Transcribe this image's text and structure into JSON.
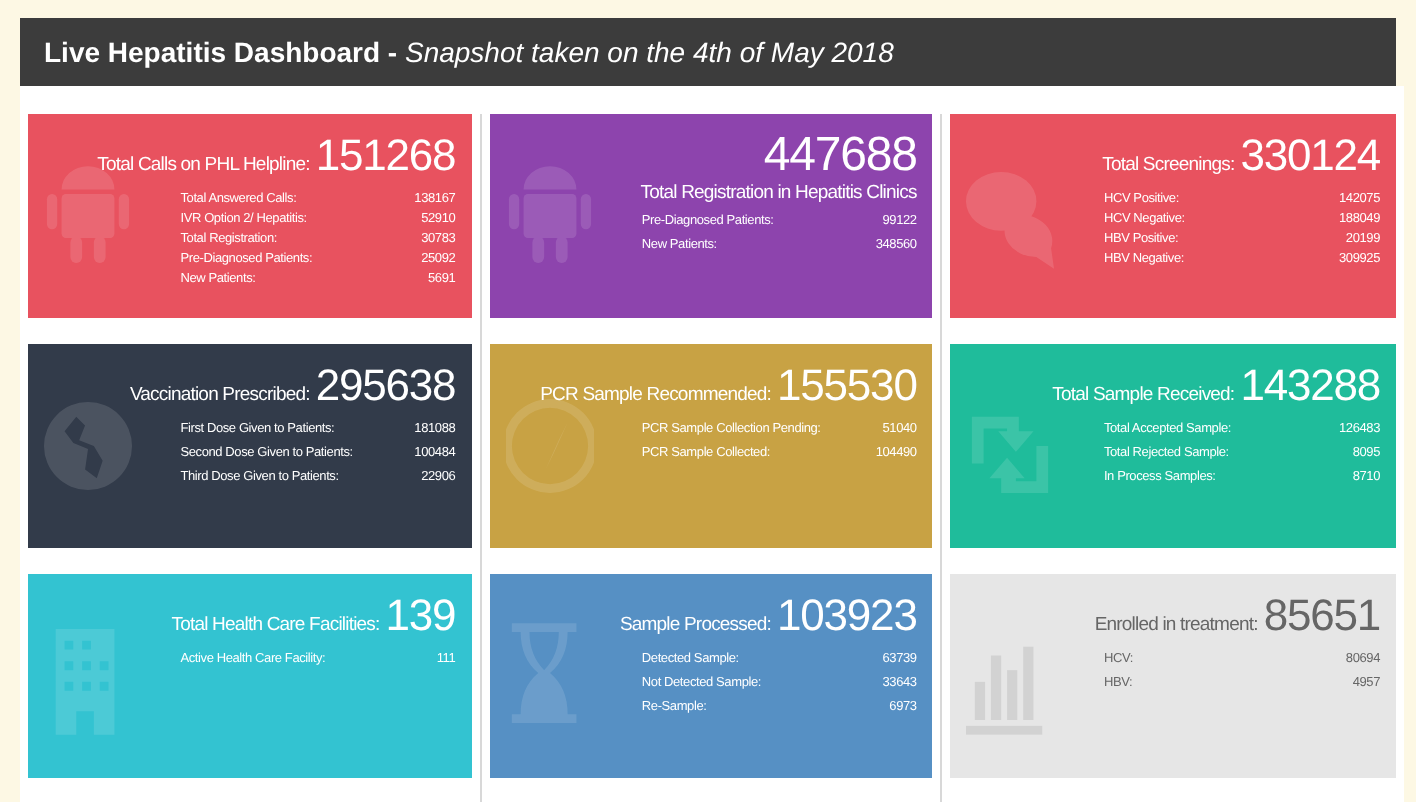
{
  "header": {
    "title": "**Live Hepatitis Dashboard -** *Snapshot taken on the 4th of May 2018*"
  },
  "cards": [
    {
      "kind": "label-first",
      "color": "#e8525f",
      "title": "Total Calls on PHL Helpline:",
      "total": "151268",
      "rows": [
        {
          "label": "Total Answered Calls:",
          "value": "138167"
        },
        {
          "label": "IVR Option 2/ Hepatitis:",
          "value": "52910"
        },
        {
          "label": "Total Registration:",
          "value": "30783"
        },
        {
          "label": "Pre-Diagnosed Patients:",
          "value": "25092"
        },
        {
          "label": "New Patients:",
          "value": "5691"
        }
      ]
    },
    {
      "kind": "number-first",
      "color": "#8d44ad",
      "title": "Total Registration in Hepatitis Clinics",
      "total": "447688",
      "rows": [
        {
          "label": "Pre-Diagnosed Patients:",
          "value": "99122"
        },
        {
          "label": "New Patients:",
          "value": "348560"
        }
      ]
    },
    {
      "kind": "label-first",
      "color": "#e8525f",
      "title": "Total Screenings:",
      "total": "330124",
      "rows": [
        {
          "label": "HCV Positive:",
          "value": "142075"
        },
        {
          "label": "HCV Negative:",
          "value": "188049"
        },
        {
          "label": "HBV Positive:",
          "value": "20199"
        },
        {
          "label": "HBV Negative:",
          "value": "309925"
        }
      ]
    },
    {
      "kind": "label-first",
      "color": "#323b4a",
      "title": "Vaccination Prescribed:",
      "total": "295638",
      "rows": [
        {
          "label": "First Dose Given to Patients:",
          "value": "181088"
        },
        {
          "label": "Second Dose Given to Patients:",
          "value": "100484"
        },
        {
          "label": "Third Dose Given to Patients:",
          "value": "22906"
        }
      ]
    },
    {
      "kind": "label-first",
      "color": "#c8a244",
      "title": "PCR Sample Recommended:",
      "total": "155530",
      "rows": [
        {
          "label": "PCR Sample Collection Pending:",
          "value": "51040"
        },
        {
          "label": "PCR Sample Collected:",
          "value": "104490"
        }
      ]
    },
    {
      "kind": "label-first",
      "color": "#1fbc9b",
      "title": "Total Sample Received:",
      "total": "143288",
      "rows": [
        {
          "label": "Total Accepted Sample:",
          "value": "126483"
        },
        {
          "label": "Total Rejected Sample:",
          "value": "8095"
        },
        {
          "label": "In Process Samples:",
          "value": "8710"
        }
      ]
    },
    {
      "kind": "label-first",
      "color": "#33c3d1",
      "title": "Total Health Care Facilities:",
      "total": "139",
      "rows": [
        {
          "label": "Active Health Care Facility:",
          "value": "111"
        }
      ]
    },
    {
      "kind": "label-first",
      "color": "#5690c4",
      "title": "Sample Processed:",
      "total": "103923",
      "rows": [
        {
          "label": "Detected Sample:",
          "value": "63739"
        },
        {
          "label": "Not Detected Sample:",
          "value": "33643"
        },
        {
          "label": "Re-Sample:",
          "value": "6973"
        }
      ]
    },
    {
      "kind": "label-first",
      "color": "#e6e6e6",
      "title": "Enrolled in treatment:",
      "total": "85651",
      "rows": [
        {
          "label": "HCV:",
          "value": "80694"
        },
        {
          "label": "HBV:",
          "value": "4957"
        }
      ]
    }
  ]
}
